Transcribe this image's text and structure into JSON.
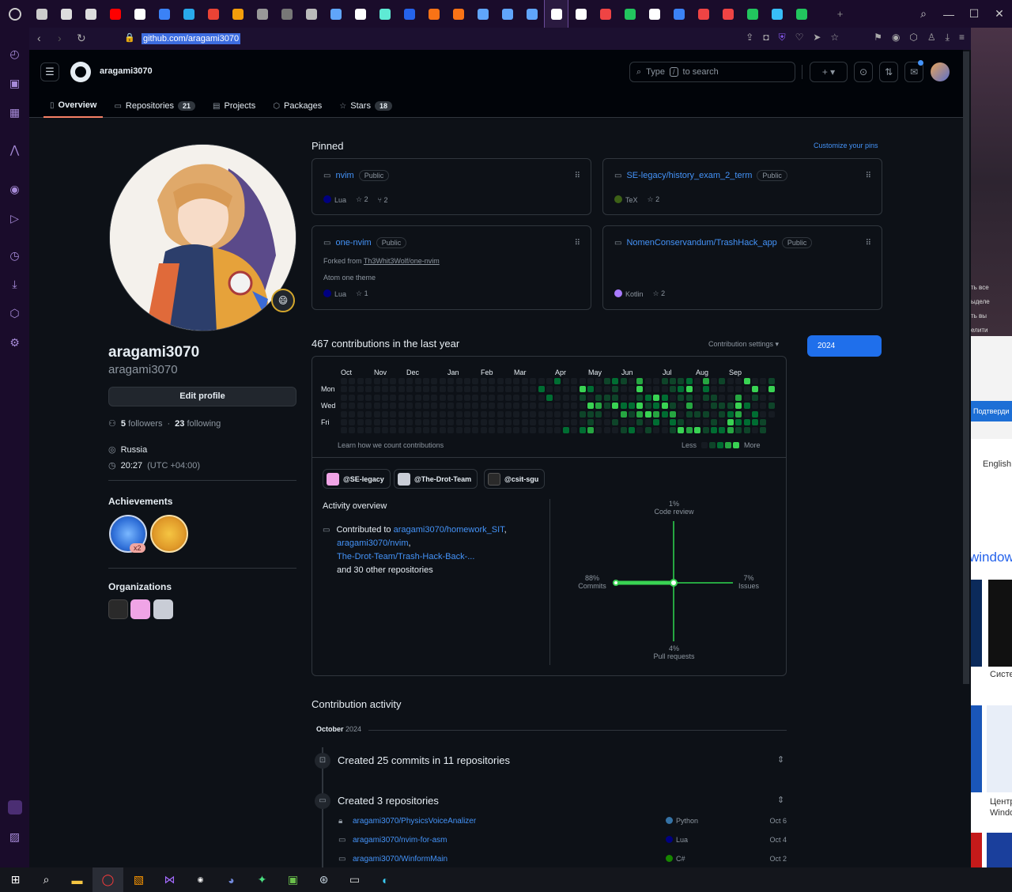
{
  "browser": {
    "url": "github.com/aragami3070",
    "nav": {
      "back": "‹",
      "forward": "›",
      "reload": "↻"
    },
    "tabs": [
      {
        "icon": "gamepad-icon",
        "color": "#cccccc"
      },
      {
        "icon": "gear-icon",
        "color": "#dddddd"
      },
      {
        "icon": "gear-icon",
        "color": "#dddddd"
      },
      {
        "icon": "youtube-icon",
        "color": "#ff0000"
      },
      {
        "icon": "google-icon",
        "color": "#ffffff"
      },
      {
        "icon": "chat-icon",
        "color": "#3b82f6"
      },
      {
        "icon": "telegram-icon",
        "color": "#29a9eb"
      },
      {
        "icon": "gmail-icon",
        "color": "#ea4335"
      },
      {
        "icon": "q-icon",
        "color": "#f59e0b"
      },
      {
        "icon": "tab-icon",
        "color": "#999999"
      },
      {
        "icon": "tab-icon",
        "color": "#777777"
      },
      {
        "icon": "tab-icon",
        "color": "#bbbbbb"
      },
      {
        "icon": "tab-icon",
        "color": "#60a5fa"
      },
      {
        "icon": "google-icon",
        "color": "#ffffff"
      },
      {
        "icon": "tab-icon",
        "color": "#5eead4"
      },
      {
        "icon": "tab-icon",
        "color": "#2563eb"
      },
      {
        "icon": "tab-icon",
        "color": "#f97316"
      },
      {
        "icon": "tab-icon",
        "color": "#f97316"
      },
      {
        "icon": "chart-icon",
        "color": "#60a5fa"
      },
      {
        "icon": "chart-icon",
        "color": "#60a5fa"
      },
      {
        "icon": "chart-icon",
        "color": "#60a5fa"
      },
      {
        "icon": "github-icon",
        "color": "#ffffff",
        "active": true
      },
      {
        "icon": "github-icon",
        "color": "#ffffff"
      },
      {
        "icon": "tab-icon",
        "color": "#ef4444"
      },
      {
        "icon": "tab-icon",
        "color": "#22c55e"
      },
      {
        "icon": "globe-icon",
        "color": "#ffffff"
      },
      {
        "icon": "tab-icon",
        "color": "#3b82f6"
      },
      {
        "icon": "tab-icon",
        "color": "#ef4444"
      },
      {
        "icon": "play-icon",
        "color": "#ef4444"
      },
      {
        "icon": "tab-icon",
        "color": "#22c55e"
      },
      {
        "icon": "tab-icon",
        "color": "#38bdf8"
      },
      {
        "icon": "tab-icon",
        "color": "#22c55e"
      }
    ]
  },
  "header": {
    "username": "aragami3070",
    "search_prefix": "Type",
    "search_key": "/",
    "search_suffix": "to search",
    "plus": "+ ▾"
  },
  "tabs": [
    {
      "label": "Overview",
      "icon": "book-icon",
      "count": ""
    },
    {
      "label": "Repositories",
      "icon": "repo-icon",
      "count": "21"
    },
    {
      "label": "Projects",
      "icon": "table-icon",
      "count": ""
    },
    {
      "label": "Packages",
      "icon": "package-icon",
      "count": ""
    },
    {
      "label": "Stars",
      "icon": "star-icon",
      "count": "18"
    }
  ],
  "profile": {
    "name": "aragami3070",
    "login": "aragami3070",
    "edit": "Edit profile",
    "followers": "5",
    "followers_label": "followers",
    "dot": "·",
    "following": "23",
    "following_label": "following",
    "location": "Russia",
    "time": "20:27",
    "tz": "(UTC +04:00)",
    "status_emoji": "😄",
    "achievements_title": "Achievements",
    "achievement_count": "x2",
    "orgs_title": "Organizations"
  },
  "pinned": {
    "title": "Pinned",
    "customize": "Customize your pins",
    "items": [
      {
        "name": "nvim",
        "badge": "Public",
        "sub1": "",
        "sub2": "",
        "lang": "Lua",
        "lang_color": "#000080",
        "stars": "2",
        "forks": "2"
      },
      {
        "name": "SE-legacy/history_exam_2_term",
        "badge": "Public",
        "sub1": "",
        "sub2": "",
        "lang": "TeX",
        "lang_color": "#3D6117",
        "stars": "2",
        "forks": ""
      },
      {
        "name": "one-nvim",
        "badge": "Public",
        "sub1_prefix": "Forked from",
        "sub1": "Th3Whit3Wolf/one-nvim",
        "sub2": "Atom one theme",
        "lang": "Lua",
        "lang_color": "#000080",
        "stars": "1",
        "forks": ""
      },
      {
        "name": "NomenConservandum/TrashHack_app",
        "badge": "Public",
        "sub1": "",
        "sub2": "",
        "lang": "Kotlin",
        "lang_color": "#A97BFF",
        "stars": "2",
        "forks": ""
      }
    ]
  },
  "contributions": {
    "title": "467 contributions in the last year",
    "settings": "Contribution settings ▾",
    "year": "2024",
    "months": [
      "Oct",
      "Nov",
      "Dec",
      "Jan",
      "Feb",
      "Mar",
      "Apr",
      "May",
      "Jun",
      "Jul",
      "Aug",
      "Sep"
    ],
    "days": [
      "Mon",
      "Wed",
      "Fri"
    ],
    "learn": "Learn how we count contributions",
    "less": "Less",
    "more": "More",
    "levels": [
      "#161b22",
      "#0e4429",
      "#006d32",
      "#26a641",
      "#39d353"
    ],
    "orgs": [
      "@SE-legacy",
      "@The-Drot-Team",
      "@csit-sgu"
    ]
  },
  "activity": {
    "title": "Activity overview",
    "contributed_to": "Contributed to",
    "repos": [
      "aragami3070/homework_SIT",
      "aragami3070/nvim",
      "The-Drot-Team/Trash-Hack-Back-..."
    ],
    "other": "and 30 other repositories",
    "code_review_pct": "1%",
    "code_review": "Code review",
    "commits_pct": "88%",
    "commits": "Commits",
    "issues_pct": "7%",
    "issues": "Issues",
    "prs_pct": "4%",
    "prs": "Pull requests",
    "axis_values": {
      "code_review": 1,
      "commits": 88,
      "issues": 7,
      "prs": 4
    }
  },
  "contribution_activity": {
    "title": "Contribution activity",
    "month": "October",
    "year": "2024",
    "event1": "Created 25 commits in 11 repositories",
    "event2": "Created 3 repositories",
    "repos": [
      {
        "name": "aragami3070/PhysicsVoiceAnalizer",
        "lang": "Python",
        "color": "#3572A5",
        "date": "Oct 6",
        "icon": "lock-icon"
      },
      {
        "name": "aragami3070/nvim-for-asm",
        "lang": "Lua",
        "color": "#000080",
        "date": "Oct 4",
        "icon": "repo-icon"
      },
      {
        "name": "aragami3070/WinformMain",
        "lang": "C#",
        "color": "#178600",
        "date": "Oct 2",
        "icon": "repo-icon"
      }
    ]
  },
  "rightstrip": {
    "texts": [
      "ть все",
      "ыделе",
      "ть вы",
      "елити",
      "Подтверди",
      "English",
      "windows",
      "Систе",
      "Центр",
      "Windo"
    ]
  }
}
